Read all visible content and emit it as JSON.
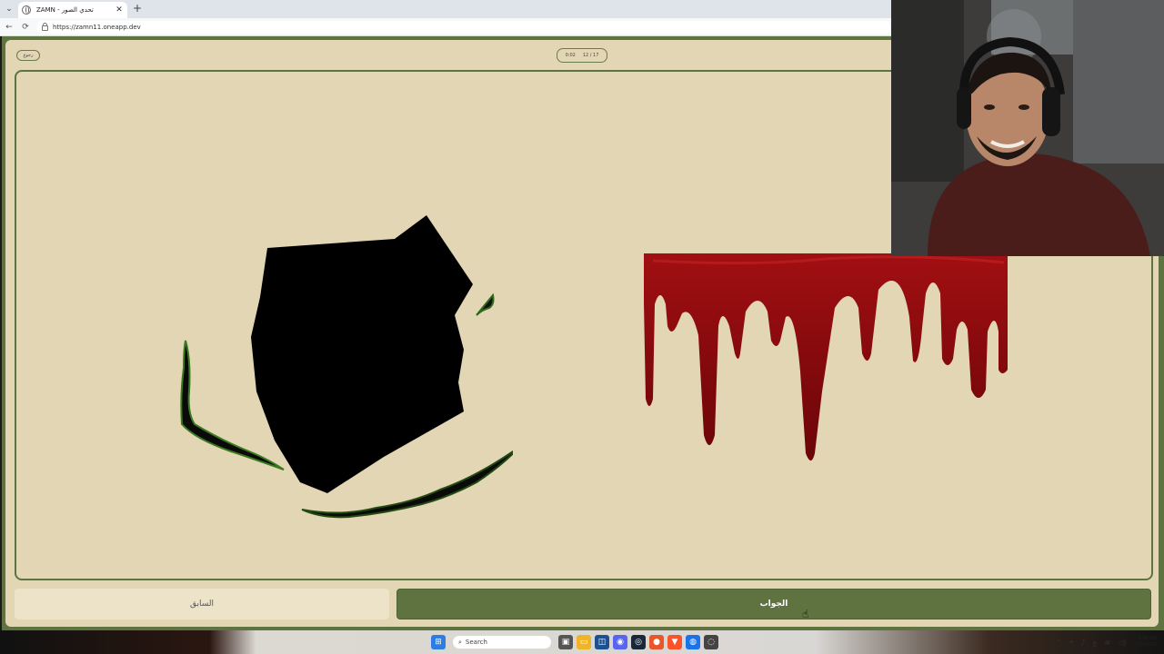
{
  "browser": {
    "tab_title": "ZAMN - تحدي الصور",
    "tab_close": "✕",
    "new_tab": "+",
    "tab_list": "⌄",
    "back": "←",
    "reload": "⟳",
    "url": "https://zamn11.oneapp.dev"
  },
  "game": {
    "back_pill": "رجوع",
    "timer": "0:02",
    "counter": "12 / 17",
    "prev_button": "السابق",
    "answer_button": "الجواب",
    "left_image_icon": "black-paper-tear-image",
    "right_image_icon": "dripping-blood-image"
  },
  "taskbar": {
    "search_placeholder": "Search",
    "time": "4:49 AM",
    "date": "2/20/2026",
    "lang": "ع"
  },
  "colors": {
    "accent_green": "#5e7340",
    "background_beige": "#e3d6b4",
    "blood_red": "#8b0d0d"
  }
}
